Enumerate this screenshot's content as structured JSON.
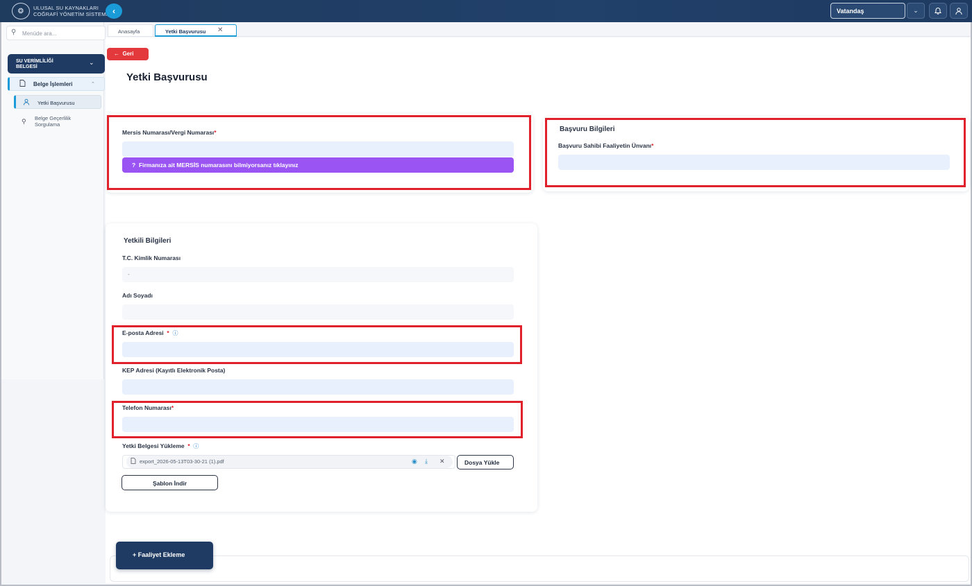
{
  "header": {
    "brand_line1": "ULUSAL SU KAYNAKLARI",
    "brand_line2": "COĞRAFİ YÖNETİM SİSTEMİ",
    "role": "Vatandaş"
  },
  "sidebar": {
    "search_placeholder": "Menüde ara...",
    "group_label_1": "SU VERİMLİLİĞİ",
    "group_label_2": "BELGESİ",
    "sub_label": "Belge İşlemleri",
    "items": [
      {
        "label": "Yetki Başvurusu"
      },
      {
        "label": "Belge Geçerlilik Sorgulama"
      }
    ]
  },
  "tabs": [
    {
      "label": "Anasayfa"
    },
    {
      "label": "Yetki Başvurusu"
    }
  ],
  "page": {
    "back_label": "Geri",
    "title": "Yetki Başvurusu"
  },
  "mersis": {
    "label": "Mersis Numarası/Vergi Numarası",
    "help": "Firmanıza ait MERSİS numarasını bilmiyorsanız tıklayınız"
  },
  "basvuru": {
    "title": "Başvuru Bilgileri",
    "label": "Başvuru Sahibi Faaliyetin Ünvanı"
  },
  "yetkili": {
    "title": "Yetkili Bilgileri",
    "tc_label": "T.C. Kimlik Numarası",
    "tc_value": "-",
    "name_label": "Adı Soyadı",
    "email_label": "E-posta Adresi",
    "kep_label": "KEP Adresi (Kayıtlı Elektronik Posta)",
    "phone_label": "Telefon Numarası",
    "upload_label": "Yetki Belgesi Yükleme",
    "file_name": "export_2026-05-13T03-30-21 (1).pdf",
    "upload_button": "Dosya Yükle",
    "template_button": "Şablon İndir"
  },
  "actions": {
    "add_activity": "Faaliyet Ekleme"
  },
  "required_mark": "*"
}
